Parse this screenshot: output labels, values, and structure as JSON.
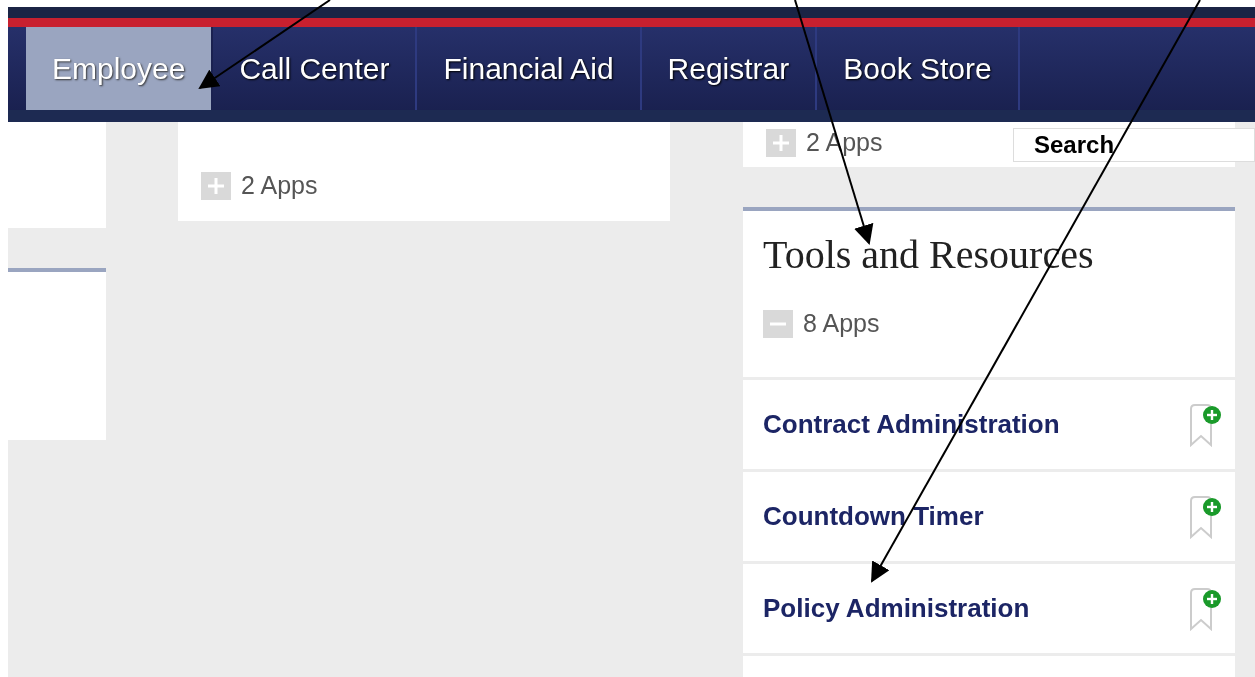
{
  "nav": {
    "tabs": [
      {
        "label": "Employee",
        "selected": true
      },
      {
        "label": "Call Center",
        "selected": false
      },
      {
        "label": "Financial Aid",
        "selected": false
      },
      {
        "label": "Registrar",
        "selected": false
      },
      {
        "label": "Book Store",
        "selected": false
      }
    ]
  },
  "search": {
    "label": "Search"
  },
  "middle_card": {
    "apps": "2 Apps",
    "expanded": false
  },
  "right_top_card": {
    "apps": "2 Apps",
    "expanded": false
  },
  "tools_card": {
    "title": "Tools and Resources",
    "apps": "8 Apps",
    "expanded": true,
    "items": [
      {
        "name": "Contract Administration"
      },
      {
        "name": "Countdown Timer"
      },
      {
        "name": "Policy Administration"
      }
    ]
  }
}
